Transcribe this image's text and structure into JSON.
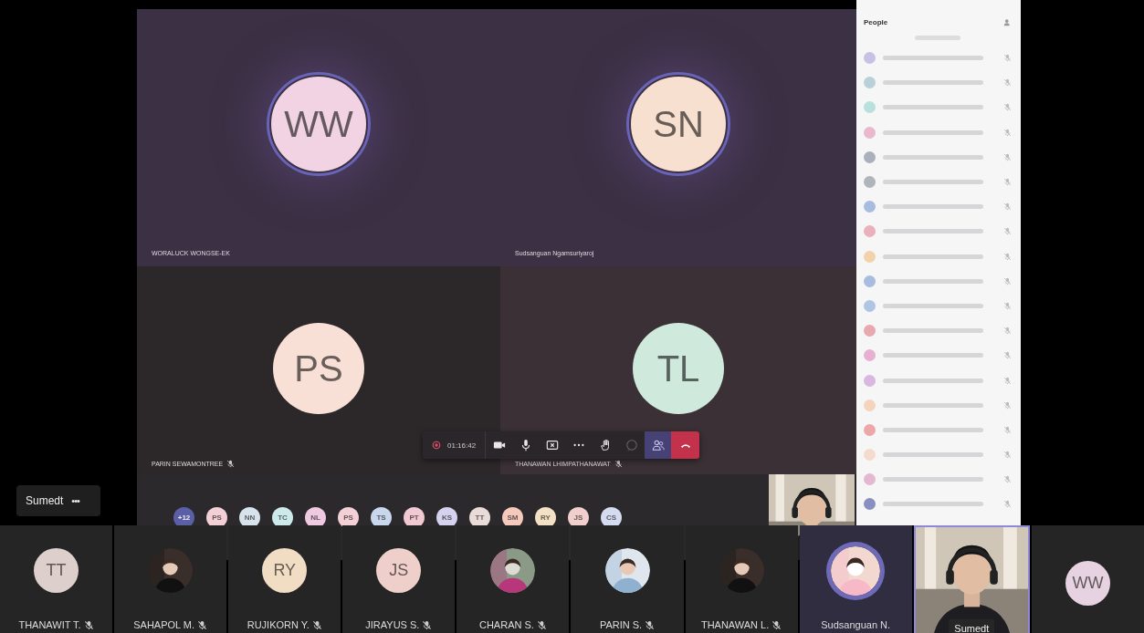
{
  "stage_tiles": [
    {
      "initials": "WW",
      "color": "#f1d3e3",
      "name": "WORALUCK WONGSE-EK",
      "speaking": true,
      "muted": false
    },
    {
      "initials": "SN",
      "color": "#f7e0cf",
      "name": "Sudsanguan Ngamsuriyaroj",
      "speaking": true,
      "muted": false
    },
    {
      "initials": "PS",
      "color": "#f8e0d6",
      "name": "PARIN SEWAMONTREE",
      "speaking": false,
      "muted": true
    },
    {
      "initials": "TL",
      "color": "#cfeadd",
      "name": "THANAWAN LHIMPATHANAWAT",
      "speaking": false,
      "muted": true
    }
  ],
  "call_controls": {
    "timer": "01:16:42",
    "buttons": [
      {
        "kind": "camera",
        "selected": false,
        "disabled": false
      },
      {
        "kind": "mic",
        "selected": false,
        "disabled": false
      },
      {
        "kind": "share",
        "selected": false,
        "disabled": false
      },
      {
        "kind": "more",
        "selected": false,
        "disabled": false
      },
      {
        "kind": "hand",
        "selected": false,
        "disabled": false
      },
      {
        "kind": "chat",
        "selected": false,
        "disabled": true
      },
      {
        "kind": "people",
        "selected": true,
        "disabled": false
      },
      {
        "kind": "hangup",
        "selected": false,
        "disabled": false
      }
    ]
  },
  "self_pill": {
    "name": "Sumedt",
    "menu": "•••"
  },
  "avatar_row": {
    "overflow": "+12",
    "avatars": [
      {
        "initials": "PS",
        "color": "#f3cfd6"
      },
      {
        "initials": "NN",
        "color": "#d7e3ea"
      },
      {
        "initials": "TC",
        "color": "#cdeaea"
      },
      {
        "initials": "NL",
        "color": "#efc9df"
      },
      {
        "initials": "PS",
        "color": "#f3cfd6"
      },
      {
        "initials": "TS",
        "color": "#c9d7ec"
      },
      {
        "initials": "PT",
        "color": "#f1c9d2"
      },
      {
        "initials": "KS",
        "color": "#d4d2ee"
      },
      {
        "initials": "TT",
        "color": "#e9dcd8"
      },
      {
        "initials": "SM",
        "color": "#f5c9bb"
      },
      {
        "initials": "RY",
        "color": "#f3e1c5"
      },
      {
        "initials": "JS",
        "color": "#f0cfcc"
      },
      {
        "initials": "CS",
        "color": "#d6dcf0"
      }
    ]
  },
  "people_panel": {
    "title": "People",
    "members": [
      {
        "color": "#c9c0e6"
      },
      {
        "color": "#b8d0d8"
      },
      {
        "color": "#b8e0dc"
      },
      {
        "color": "#e8b8cc"
      },
      {
        "color": "#aab0bc"
      },
      {
        "color": "#b0b4bc"
      },
      {
        "color": "#a8bce0"
      },
      {
        "color": "#eab0bc"
      },
      {
        "color": "#f2d2a8"
      },
      {
        "color": "#a8bce0"
      },
      {
        "color": "#b0c4e4"
      },
      {
        "color": "#e8a8b0"
      },
      {
        "color": "#e8b0d0"
      },
      {
        "color": "#d8b8e0"
      },
      {
        "color": "#f4d4bc"
      },
      {
        "color": "#eca8a8"
      },
      {
        "color": "#f4dccc"
      },
      {
        "color": "#e4b8d0"
      },
      {
        "color": "#8890c0"
      }
    ]
  },
  "participants": [
    {
      "name": "THANAWIT T.",
      "muted": true,
      "kind": "initials",
      "initials": "TT",
      "color": "#ddd0cc",
      "speaking": false
    },
    {
      "name": "SAHAPOL M.",
      "muted": true,
      "speaking": false
    },
    {
      "name": "RUJIKORN Y.",
      "muted": true,
      "kind": "initials",
      "initials": "RY",
      "color": "#f1dcc4",
      "speaking": false
    },
    {
      "name": "JIRAYUS S.",
      "muted": true,
      "kind": "initials",
      "initials": "JS",
      "color": "#efcfc9",
      "speaking": false
    },
    {
      "name": "CHARAN S.",
      "muted": true,
      "speaking": false
    },
    {
      "name": "PARIN S.",
      "muted": true,
      "speaking": false
    },
    {
      "name": "THANAWAN L.",
      "muted": true,
      "speaking": false
    },
    {
      "name": "Sudsanguan N.",
      "muted": false,
      "speaking": true
    },
    {
      "name": "Sumedt",
      "kind": "video",
      "speaking": true
    },
    {
      "kind": "initials",
      "initials": "WW",
      "color": "#e6d2e0",
      "speaking": false
    }
  ]
}
